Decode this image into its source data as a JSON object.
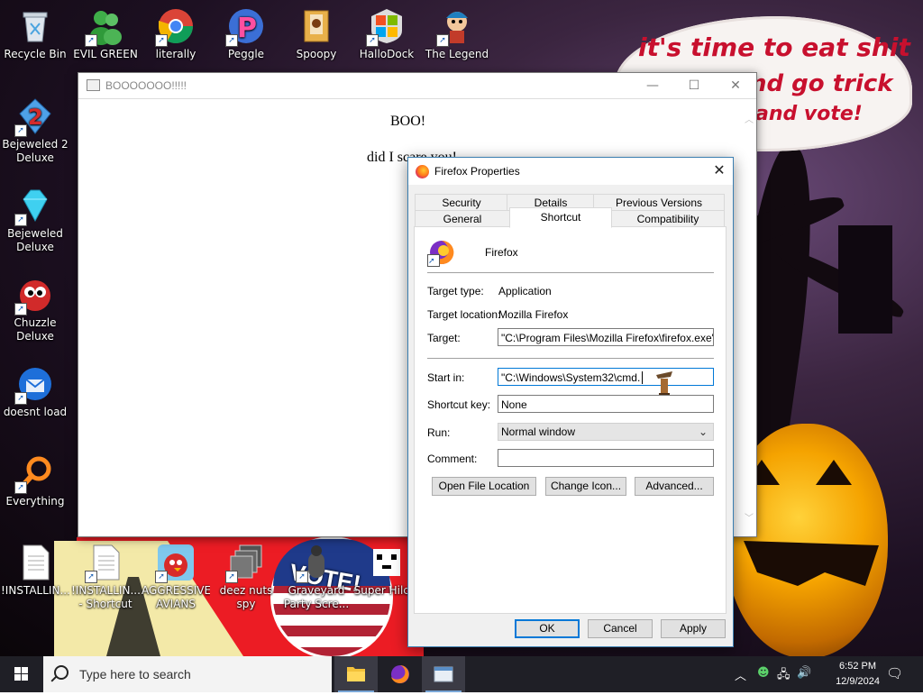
{
  "desktop": {
    "icons": [
      {
        "label": "Recycle Bin"
      },
      {
        "label": "EVIL GREEN MEN CO..."
      },
      {
        "label": "literally chrome"
      },
      {
        "label": "Peggle Nights Deluxe"
      },
      {
        "label": "Spoopy"
      },
      {
        "label": "HalloDock"
      },
      {
        "label": "The Legend of Tikl..."
      },
      {
        "label": "Bejeweled 2 Deluxe"
      },
      {
        "label": "Bejeweled Deluxe"
      },
      {
        "label": "Chuzzle Deluxe"
      },
      {
        "label": "doesnt load"
      },
      {
        "label": "Everything"
      },
      {
        "label": "!INSTALLIN..."
      },
      {
        "label": "!INSTALLIN... - Shortcut"
      },
      {
        "label": "AGGRESSIVE AVIANS"
      },
      {
        "label": "deez nuts spy"
      },
      {
        "label": "Graveyard Party Scre..."
      },
      {
        "label": "Super Hilc..."
      }
    ],
    "wallpaper_text": {
      "line1": "it's time to eat shit",
      "line2": "nd go trick",
      "line3": "and vote!"
    },
    "vote_text": "VOTE!"
  },
  "boo_window": {
    "title": "BOOOOOOO!!!!!",
    "heading": "BOO!",
    "subtext": "did I scare you!"
  },
  "props_dialog": {
    "title": "Firefox Properties",
    "tabs_row1": [
      "Security",
      "Details",
      "Previous Versions"
    ],
    "tabs_row2": [
      "General",
      "Shortcut",
      "Compatibility"
    ],
    "active_tab": "Shortcut",
    "app_name": "Firefox",
    "target_type_label": "Target type:",
    "target_type_value": "Application",
    "target_location_label": "Target location:",
    "target_location_value": "Mozilla Firefox",
    "target_label": "Target:",
    "target_value": "\"C:\\Program Files\\Mozilla Firefox\\firefox.exe\"",
    "start_in_label": "Start in:",
    "start_in_value": "\"C:\\Windows\\System32\\cmd.",
    "shortcut_key_label": "Shortcut key:",
    "shortcut_key_value": "None",
    "run_label": "Run:",
    "run_value": "Normal window",
    "comment_label": "Comment:",
    "comment_value": "",
    "buttons": {
      "open_file_location": "Open File Location",
      "change_icon": "Change Icon...",
      "advanced": "Advanced...",
      "ok": "OK",
      "cancel": "Cancel",
      "apply": "Apply"
    }
  },
  "taskbar": {
    "search_placeholder": "Type here to search",
    "time": "6:52 PM",
    "date": "12/9/2024"
  }
}
